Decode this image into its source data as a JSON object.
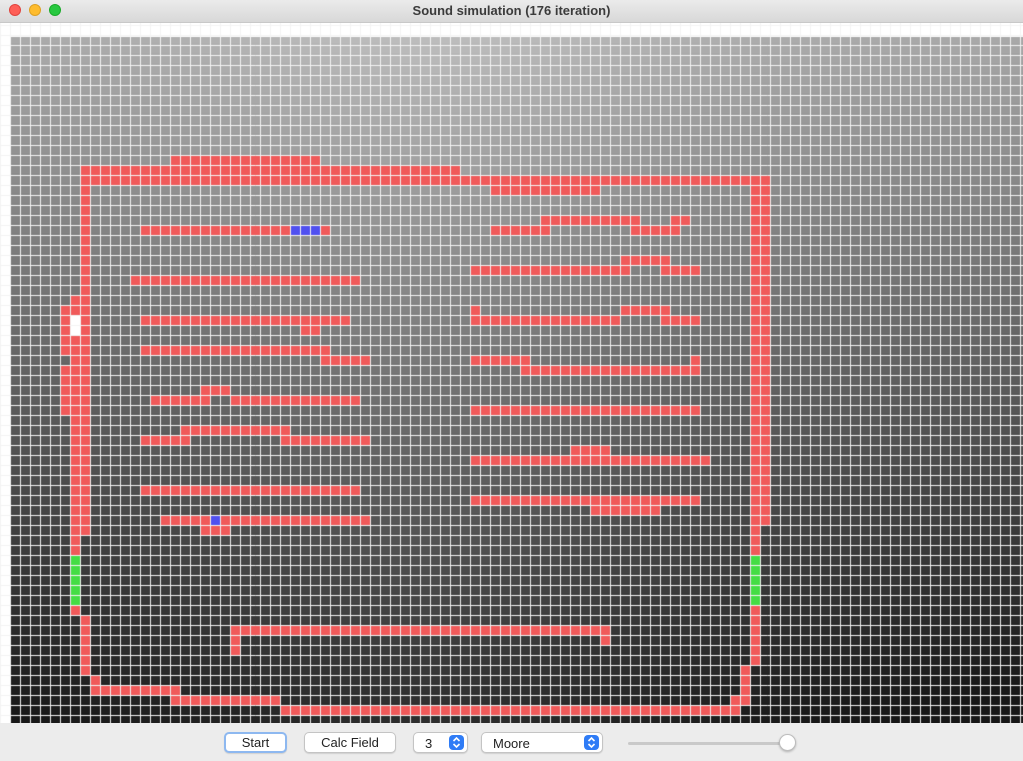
{
  "window": {
    "title": "Sound simulation (176 iteration)"
  },
  "toolbar": {
    "start_label": "Start",
    "calc_field_label": "Calc Field",
    "radius_value": "3",
    "neighborhood_value": "Moore",
    "slider_value": 1.0
  },
  "icons": {
    "close": "close-icon",
    "minimize": "minimize-icon",
    "maximize": "maximize-icon",
    "stepper": "stepper-icon"
  },
  "colors": {
    "wall": "#f05a5a",
    "listener": "#5050f0",
    "source": "#44dd44",
    "marker": "#ffffff",
    "grid_line": "#f4f4f4",
    "accent": "#2f7cf6"
  }
}
